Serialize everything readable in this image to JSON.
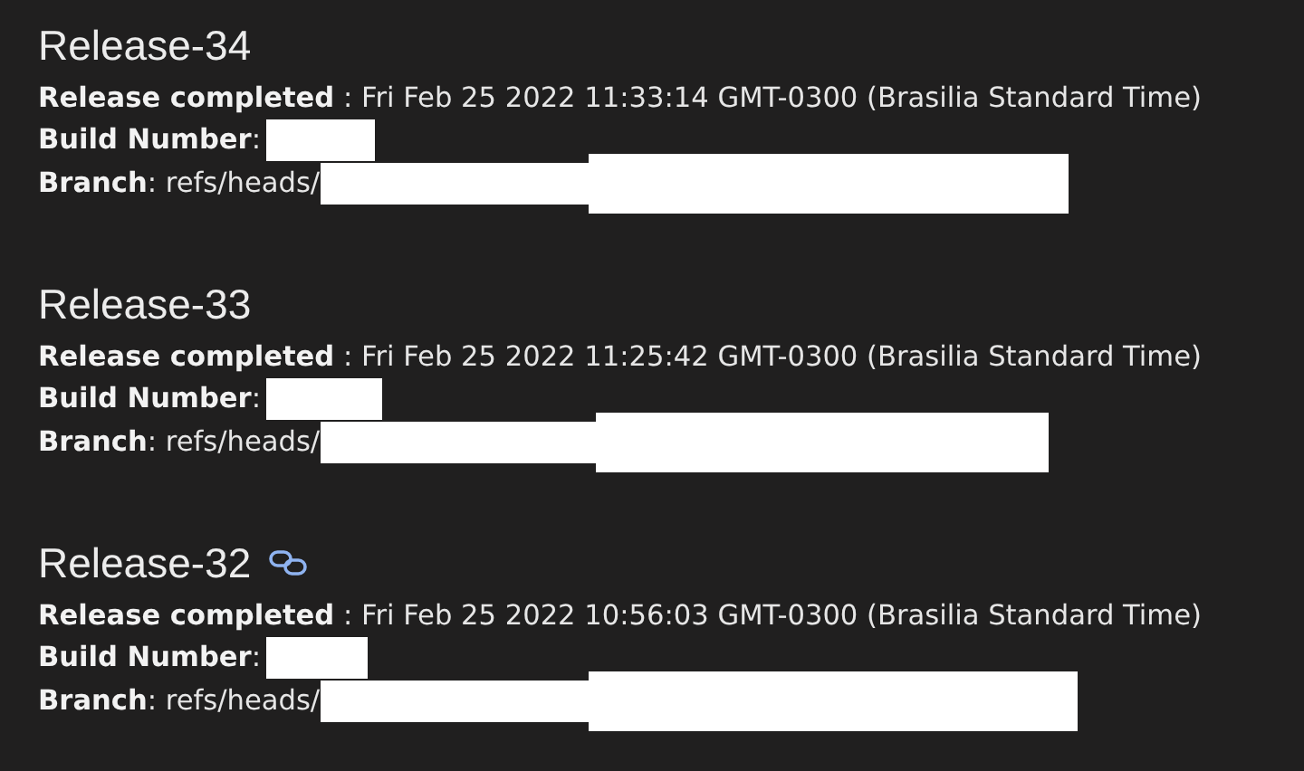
{
  "releases": [
    {
      "title": "Release-34",
      "link_icon": false,
      "completed_line": "**Release completed** : Fri Feb 25 2022 11:33:14 GMT-0300 (Brasilia Standard Time)",
      "build_label": "**Build Number**:",
      "branch_line": "**Branch**: refs/heads/"
    },
    {
      "title": "Release-33",
      "link_icon": false,
      "completed_line": "**Release completed** : Fri Feb 25 2022 11:25:42 GMT-0300 (Brasilia Standard Time)",
      "build_label": "**Build Number**:",
      "branch_line": "**Branch**: refs/heads/"
    },
    {
      "title": "Release-32",
      "link_icon": true,
      "completed_line": "**Release completed** : Fri Feb 25 2022 10:56:03 GMT-0300 (Brasilia Standard Time)",
      "build_label": "**Build Number**:",
      "branch_line": "**Branch**: refs/heads/"
    }
  ]
}
